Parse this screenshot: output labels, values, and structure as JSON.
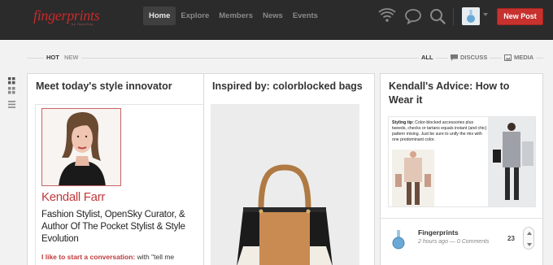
{
  "brand": {
    "logo": "fingerprints",
    "logo_sub": "by OpenSky"
  },
  "nav": {
    "items": [
      "Home",
      "Explore",
      "Members",
      "News",
      "Events"
    ],
    "active": "Home"
  },
  "top_actions": {
    "new_post": "New Post",
    "icons": [
      "wifi-icon",
      "chat-icon",
      "search-icon",
      "avatar",
      "chevron-down-icon"
    ]
  },
  "filters": {
    "hot": "HOT",
    "new": "NEW",
    "all": "ALL",
    "discuss": "DISCUSS",
    "media": "MEDIA"
  },
  "cards": [
    {
      "title": "Meet today's style innovator",
      "name": "Kendall Farr",
      "description": "Fashion Stylist, OpenSky Curator, & Author Of The Pocket Stylist & Style Evolution",
      "quote_lead": "I like to start a conversation:",
      "quote_rest": " with \"tell me"
    },
    {
      "title": "Inspired by: colorblocked bags"
    },
    {
      "title": "Kendall's Advice: How to Wear it",
      "tip_label": "Styling tip:",
      "tip_text": " Color-blocked accessories plus tweeds, checks or tartans equals instant (and chic) pattern mixing. Just be sure to unify the mix with one predominant color.",
      "author": "Fingerprints",
      "meta": "2 hours ago — 0 Comments",
      "votes": "23"
    }
  ],
  "colors": {
    "brand_red": "#c7322f",
    "topbar": "#2b2b2b",
    "accent_name": "#c0393b"
  }
}
